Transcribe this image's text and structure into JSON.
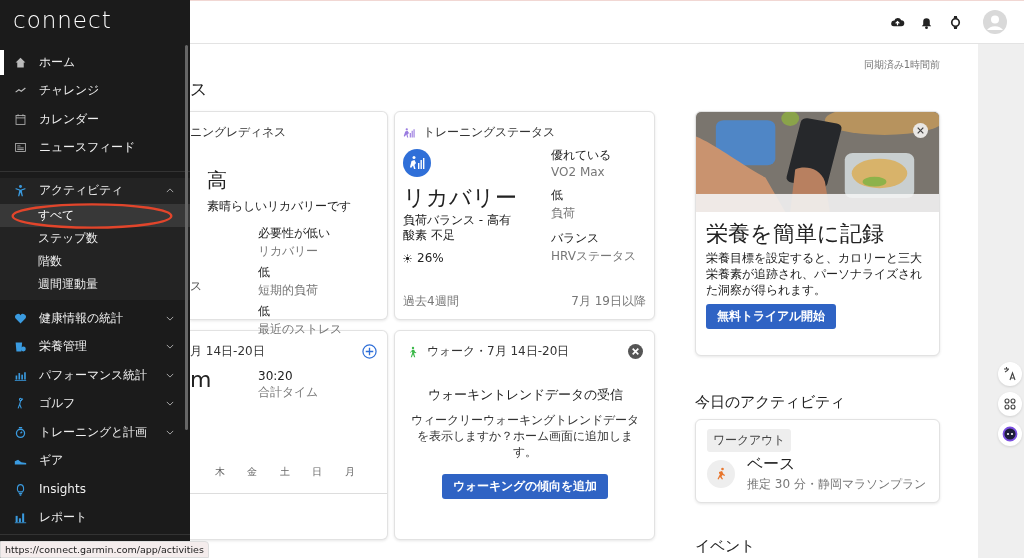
{
  "sidebar": {
    "logo": "connect",
    "items": [
      {
        "label": "ホーム",
        "selected": true
      },
      {
        "label": "チャレンジ",
        "selected": false
      },
      {
        "label": "カレンダー",
        "selected": false
      },
      {
        "label": "ニュースフィード",
        "selected": false
      },
      {
        "label": "アクティビティ",
        "selected": false,
        "expanded": true,
        "children": [
          {
            "label": "すべて",
            "selected": true
          },
          {
            "label": "ステップ数",
            "selected": false
          },
          {
            "label": "階数",
            "selected": false
          },
          {
            "label": "週間運動量",
            "selected": false
          }
        ]
      },
      {
        "label": "健康情報の統計",
        "selected": false,
        "expanded": false
      },
      {
        "label": "栄養管理",
        "selected": false,
        "expanded": false
      },
      {
        "label": "パフォーマンス統計",
        "selected": false,
        "expanded": false
      },
      {
        "label": "ゴルフ",
        "selected": false,
        "expanded": false
      },
      {
        "label": "トレーニングと計画",
        "selected": false,
        "expanded": false
      },
      {
        "label": "ギア",
        "selected": false
      },
      {
        "label": "Insights",
        "selected": false
      },
      {
        "label": "レポート",
        "selected": false
      }
    ]
  },
  "status_url": "https://connect.garmin.com/app/activities",
  "sync_text": "同期済み1時間前",
  "section_heading": "ス",
  "readiness_card": {
    "title": "ニングレディネス",
    "value": "高",
    "subtitle": "素晴らしいリカバリーです",
    "stats": [
      {
        "value": "必要性が低い",
        "label": "リカバリー"
      },
      {
        "value": "低",
        "label": "短期的負荷",
        "left_fragment": "ス"
      },
      {
        "value": "低",
        "label": "最近のストレス"
      }
    ]
  },
  "status_card": {
    "title": "トレーニングステータス",
    "value": "リカバリー",
    "subtitle": "負荷バランス - 高有酸素 不足",
    "percent": "26%",
    "stats": [
      {
        "value": "優れている",
        "label": "VO2 Max"
      },
      {
        "value": "低",
        "label": "負荷"
      },
      {
        "value": "バランス",
        "label": "HRVステータス"
      }
    ],
    "footer_left": "過去4週間",
    "footer_right": "7月 19日以降"
  },
  "running_card": {
    "header": "月 14日-20日",
    "value": "m",
    "stat_value": "30:20",
    "stat_label": "合計タイム",
    "days": [
      "木",
      "金",
      "土",
      "日",
      "月"
    ]
  },
  "walk_card": {
    "header": "ウォーク・7月 14日-20日",
    "title": "ウォーキントレンドデータの受信",
    "body": "ウィークリーウォーキングトレンドデータを表示しますか？ホーム画面に追加します。",
    "button": "ウォーキングの傾向を追加"
  },
  "promo_card": {
    "title": "栄養を簡単に記録",
    "body": "栄養目標を設定すると、カロリーと三大栄養素が追跡され、パーソナライズされた洞察が得られます。",
    "button": "無料トライアル開始"
  },
  "today": {
    "heading": "今日のアクティビティ",
    "tag": "ワークアウト",
    "title": "ベース",
    "detail": "推定 30 分・静岡マラソンプラン"
  },
  "events_heading": "イベント"
}
